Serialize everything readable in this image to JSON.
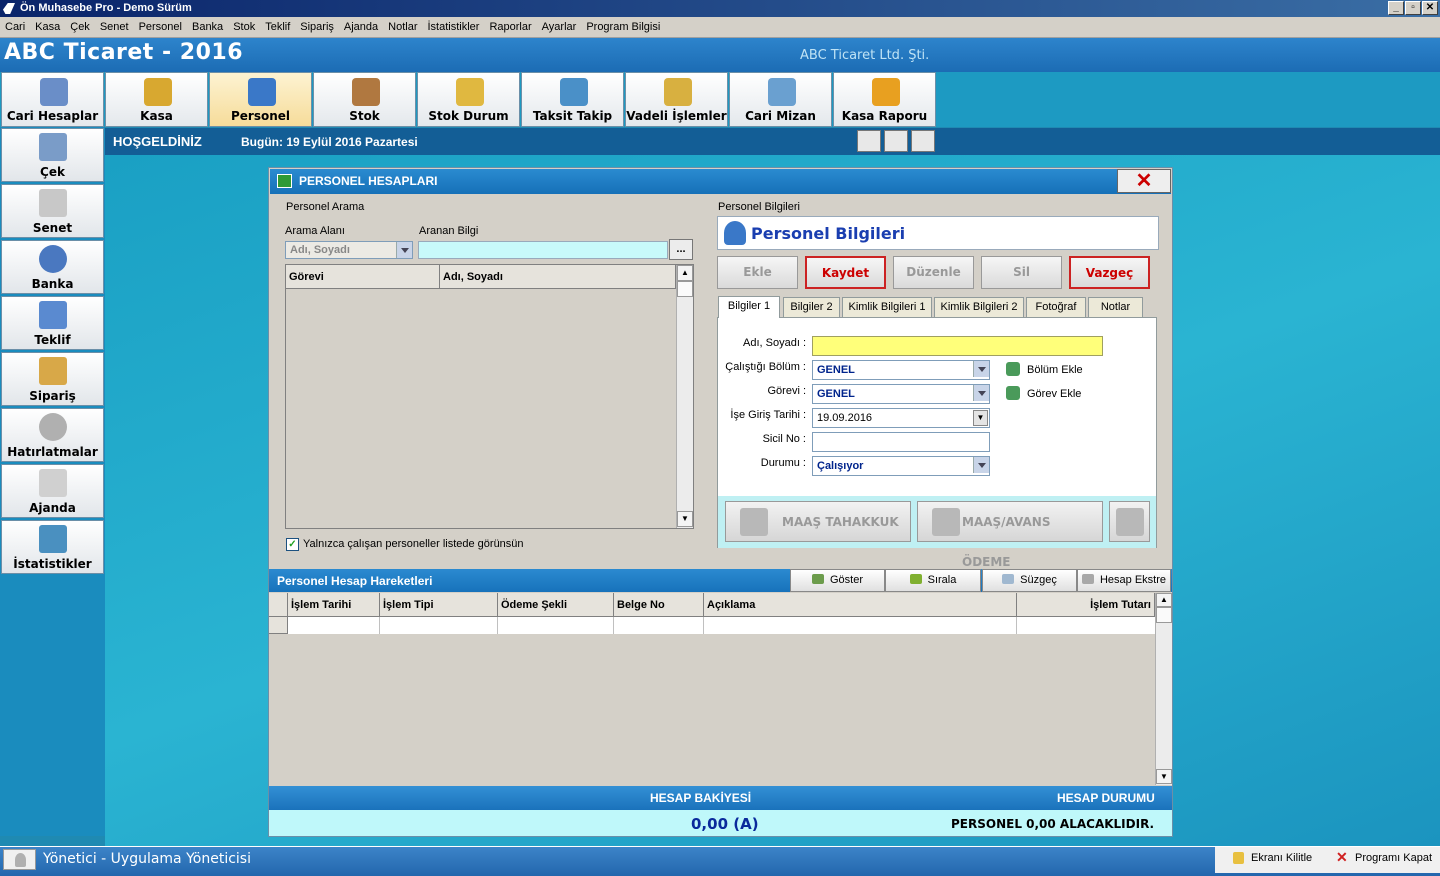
{
  "window": {
    "title": "Ön Muhasebe Pro - Demo Sürüm"
  },
  "menu": [
    "Cari",
    "Kasa",
    "Çek",
    "Senet",
    "Personel",
    "Banka",
    "Stok",
    "Teklif",
    "Sipariş",
    "Ajanda",
    "Notlar",
    "İstatistikler",
    "Raporlar",
    "Ayarlar",
    "Program Bilgisi"
  ],
  "header": {
    "app_title": "ABC Ticaret - 2016",
    "company": "ABC Ticaret Ltd. Şti."
  },
  "toolbar": [
    "Cari Hesaplar",
    "Kasa",
    "Personel",
    "Stok",
    "Stok Durum",
    "Taksit Takip",
    "Vadeli İşlemler",
    "Cari Mizan",
    "Kasa Raporu"
  ],
  "welcome": {
    "greeting": "HOŞGELDİNİZ",
    "today": "Bugün: 19 Eylül 2016 Pazartesi"
  },
  "sidebar": [
    "Çek",
    "Senet",
    "Banka",
    "Teklif",
    "Sipariş",
    "Hatırlatmalar",
    "Ajanda",
    "İstatistikler"
  ],
  "dialog": {
    "title": "PERSONEL HESAPLARI",
    "close": "✕",
    "search": {
      "section": "Personel Arama",
      "area_label": "Arama Alanı",
      "area_value": "Adı, Soyadı",
      "query_label": "Aranan Bilgi",
      "query_value": "",
      "browse": "...",
      "col_role": "Görevi",
      "col_name": "Adı, Soyadı",
      "only_active": "Yalnızca çalışan personeller listede görünsün"
    },
    "info": {
      "section": "Personel Bilgileri",
      "heading": "Personel Bilgileri",
      "actions": [
        "Ekle",
        "Kaydet",
        "Düzenle",
        "Sil",
        "Vazgeç"
      ],
      "tabs": [
        "Bilgiler 1",
        "Bilgiler 2",
        "Kimlik Bilgileri 1",
        "Kimlik Bilgileri 2",
        "Fotoğraf",
        "Notlar"
      ],
      "labels": {
        "name": "Adı, Soyadı :",
        "dept": "Çalıştığı Bölüm :",
        "role": "Görevi :",
        "start": "İşe Giriş Tarihi :",
        "reg": "Sicil No :",
        "status": "Durumu :"
      },
      "values": {
        "name": "",
        "dept": "GENEL",
        "role": "GENEL",
        "start": "19.09.2016",
        "reg": "",
        "status": "Çalışıyor"
      },
      "add_dept": "Bölüm Ekle",
      "add_role": "Görev Ekle",
      "salary_accrual": "MAAŞ TAHAKKUK",
      "salary_payment": "MAAŞ/AVANS ÖDEME"
    },
    "movements": {
      "title": "Personel Hesap Hareketleri",
      "buttons": [
        "Göster",
        "Sırala",
        "Süzgeç",
        "Hesap Ekstre"
      ],
      "columns": [
        "İşlem Tarihi",
        "İşlem Tipi",
        "Ödeme Şekli",
        "Belge No",
        "Açıklama",
        "İşlem Tutarı"
      ]
    },
    "footer": {
      "balance_label": "HESAP BAKİYESİ",
      "status_label": "HESAP DURUMU",
      "balance_value": "0,00 (A)",
      "status_value": "PERSONEL 0,00 ALACAKLIDIR."
    }
  },
  "status": {
    "user": "Yönetici - Uygulama Yöneticisi",
    "lock": "Ekranı Kilitle",
    "exit": "Programı Kapat"
  }
}
